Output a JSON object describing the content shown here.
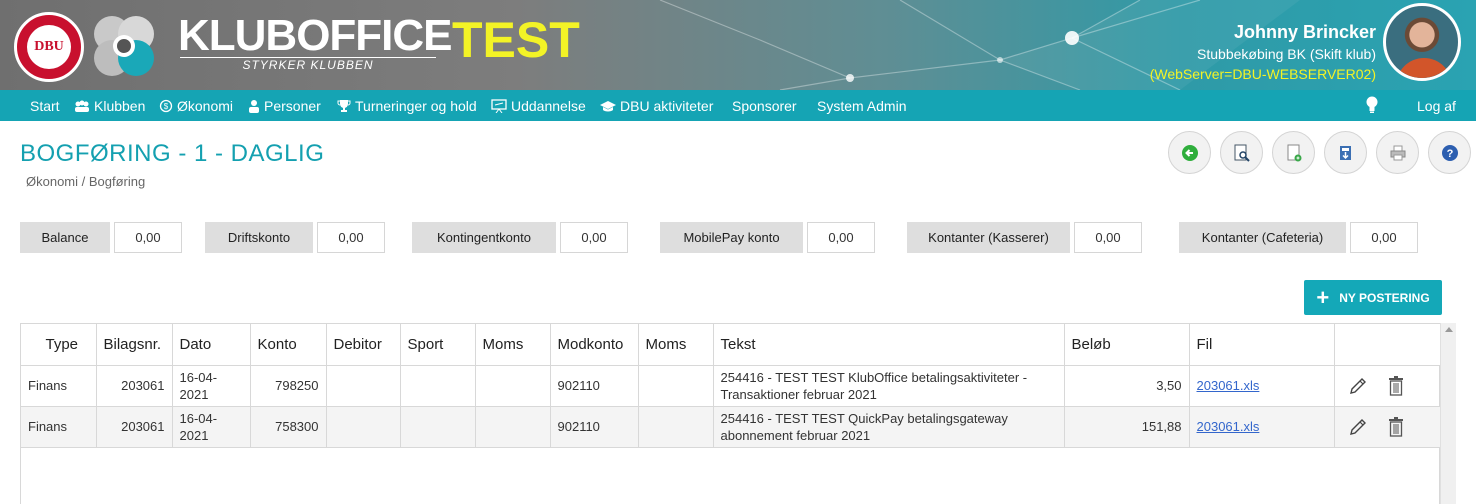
{
  "header": {
    "dbu_logo_text": "DBU",
    "brand": "KLUBOFFICE",
    "brand_sub": "STYRKER KLUBBEN",
    "brand_env": "TEST",
    "user_name": "Johnny Brincker",
    "user_club": "Stubbekøbing BK (Skift klub)",
    "server": "(WebServer=DBU-WEBSERVER02)"
  },
  "nav": {
    "items": [
      {
        "label": "Start"
      },
      {
        "label": "Klubben"
      },
      {
        "label": "Økonomi"
      },
      {
        "label": "Personer"
      },
      {
        "label": "Turneringer og hold"
      },
      {
        "label": "Uddannelse"
      },
      {
        "label": "DBU aktiviteter"
      },
      {
        "label": "Sponsorer"
      },
      {
        "label": "System Admin"
      }
    ],
    "logout": "Log af"
  },
  "page": {
    "title": "BOGFØRING - 1 - DAGLIG",
    "breadcrumb": "Økonomi / Bogføring"
  },
  "balances": [
    {
      "label": "Balance",
      "value": "0,00"
    },
    {
      "label": "Driftskonto",
      "value": "0,00"
    },
    {
      "label": "Kontingentkonto",
      "value": "0,00"
    },
    {
      "label": "MobilePay konto",
      "value": "0,00"
    },
    {
      "label": "Kontanter (Kasserer)",
      "value": "0,00"
    },
    {
      "label": "Kontanter (Cafeteria)",
      "value": "0,00"
    }
  ],
  "new_button": "NY POSTERING",
  "table": {
    "headers": [
      "Type",
      "Bilagsnr.",
      "Dato",
      "Konto",
      "Debitor",
      "Sport",
      "Moms",
      "Modkonto",
      "Moms",
      "Tekst",
      "Beløb",
      "Fil",
      ""
    ],
    "rows": [
      {
        "type": "Finans",
        "bilagsnr": "203061",
        "dato": "16-04-2021",
        "konto": "798250",
        "debitor": "",
        "sport": "",
        "moms": "",
        "modkonto": "902110",
        "moms2": "",
        "tekst": "254416 - TEST TEST KlubOffice betalingsaktiviteter - Transaktioner februar 2021",
        "beloeb": "3,50",
        "fil": "203061.xls"
      },
      {
        "type": "Finans",
        "bilagsnr": "203061",
        "dato": "16-04-2021",
        "konto": "758300",
        "debitor": "",
        "sport": "",
        "moms": "",
        "modkonto": "902110",
        "moms2": "",
        "tekst": "254416 - TEST TEST QuickPay betalingsgateway abonnement februar 2021",
        "beloeb": "151,88",
        "fil": "203061.xls"
      }
    ]
  },
  "colors": {
    "accent": "#15a4b4",
    "test_yellow": "#f3f326",
    "dbu_red": "#c8102e"
  }
}
